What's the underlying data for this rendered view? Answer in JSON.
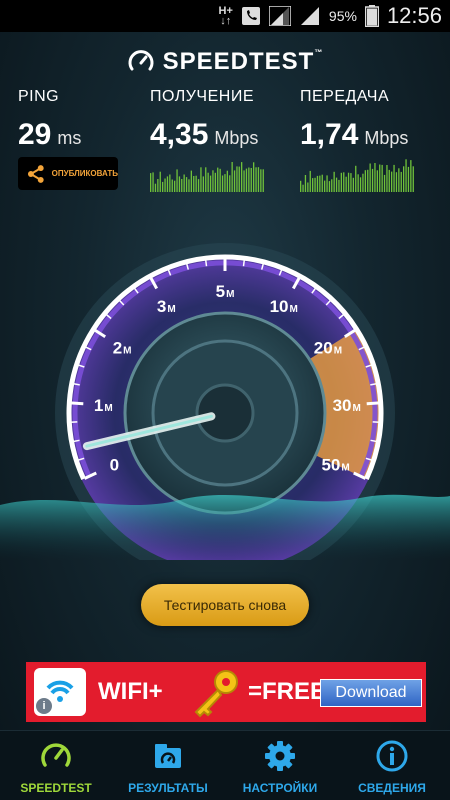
{
  "status_bar": {
    "network_type": "H+",
    "battery_percent": "95%",
    "time": "12:56"
  },
  "app": {
    "name": "SPEEDTEST",
    "trademark": "™"
  },
  "stats": {
    "ping": {
      "label": "PING",
      "value": "29",
      "unit": "ms"
    },
    "download": {
      "label": "ПОЛУЧЕНИЕ",
      "value": "4,35",
      "unit": "Mbps"
    },
    "upload": {
      "label": "ПЕРЕДАЧА",
      "value": "1,74",
      "unit": "Mbps"
    }
  },
  "share_button": {
    "label": "ОПУБЛИКОВАТЬ"
  },
  "gauge": {
    "labels": [
      {
        "num": "0",
        "suffix": ""
      },
      {
        "num": "1",
        "suffix": "M"
      },
      {
        "num": "2",
        "suffix": "M"
      },
      {
        "num": "3",
        "suffix": "M"
      },
      {
        "num": "5",
        "suffix": "M"
      },
      {
        "num": "10",
        "suffix": "M"
      },
      {
        "num": "20",
        "suffix": "M"
      },
      {
        "num": "30",
        "suffix": "M"
      },
      {
        "num": "50",
        "suffix": "M"
      }
    ],
    "needle_value_mbps": 0.4,
    "highlight_range_start": "20M",
    "highlight_range_end": "50M",
    "accent_color": "#f0a040",
    "dial_color": "#7b4fd8"
  },
  "retest_button": {
    "label": "Тестировать снова"
  },
  "ad": {
    "text_left": "WIFI+",
    "text_right": "=FREE",
    "download_label": "Download",
    "info_label": "i",
    "background_color": "#e31c2d"
  },
  "nav": {
    "items": [
      {
        "label": "SPEEDTEST",
        "icon": "speedometer-icon",
        "active": true
      },
      {
        "label": "РЕЗУЛЬТАТЫ",
        "icon": "results-icon",
        "active": false
      },
      {
        "label": "НАСТРОЙКИ",
        "icon": "gear-icon",
        "active": false
      },
      {
        "label": "СВЕДЕНИЯ",
        "icon": "info-icon",
        "active": false
      }
    ],
    "active_color": "#9fd83a",
    "inactive_color": "#2ea8ea"
  }
}
